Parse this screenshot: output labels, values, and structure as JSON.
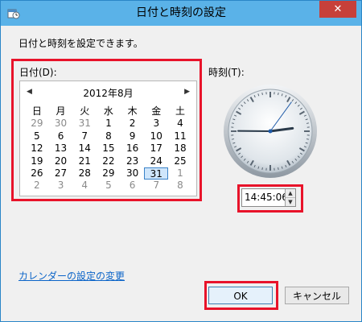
{
  "window": {
    "title": "日付と時刻の設定",
    "close_label": "✕"
  },
  "instruction": "日付と時刻を設定できます。",
  "date_section": {
    "label": "日付(D):",
    "calendar": {
      "month_label": "2012年8月",
      "prev_glyph": "◀",
      "next_glyph": "▶",
      "weekdays": [
        "日",
        "月",
        "火",
        "水",
        "木",
        "金",
        "土"
      ],
      "days": [
        {
          "d": "29",
          "other": true
        },
        {
          "d": "30",
          "other": true
        },
        {
          "d": "31",
          "other": true
        },
        {
          "d": "1"
        },
        {
          "d": "2"
        },
        {
          "d": "3"
        },
        {
          "d": "4"
        },
        {
          "d": "5"
        },
        {
          "d": "6"
        },
        {
          "d": "7"
        },
        {
          "d": "8"
        },
        {
          "d": "9"
        },
        {
          "d": "10"
        },
        {
          "d": "11"
        },
        {
          "d": "12"
        },
        {
          "d": "13"
        },
        {
          "d": "14"
        },
        {
          "d": "15"
        },
        {
          "d": "16"
        },
        {
          "d": "17"
        },
        {
          "d": "18"
        },
        {
          "d": "19"
        },
        {
          "d": "20"
        },
        {
          "d": "21"
        },
        {
          "d": "22"
        },
        {
          "d": "23"
        },
        {
          "d": "24"
        },
        {
          "d": "25"
        },
        {
          "d": "26"
        },
        {
          "d": "27"
        },
        {
          "d": "28"
        },
        {
          "d": "29"
        },
        {
          "d": "30"
        },
        {
          "d": "31",
          "selected": true
        },
        {
          "d": "1",
          "other": true
        },
        {
          "d": "2",
          "other": true
        },
        {
          "d": "3",
          "other": true
        },
        {
          "d": "4",
          "other": true
        },
        {
          "d": "5",
          "other": true
        },
        {
          "d": "6",
          "other": true
        },
        {
          "d": "7",
          "other": true
        },
        {
          "d": "8",
          "other": true
        }
      ]
    }
  },
  "time_section": {
    "label": "時刻(T):",
    "value": "14:45:06",
    "clock": {
      "hour": 14,
      "minute": 45,
      "second": 6
    }
  },
  "links": {
    "change_calendar": "カレンダーの設定の変更"
  },
  "buttons": {
    "ok": "OK",
    "cancel": "キャンセル"
  },
  "colors": {
    "title_bar": "#5ab2e8",
    "close_button": "#c7403a",
    "highlight": "#e8132a",
    "link": "#0b64c8"
  },
  "icons": {
    "app": "date-time-icon",
    "spin_up": "spin-up-icon",
    "spin_down": "spin-down-icon"
  }
}
